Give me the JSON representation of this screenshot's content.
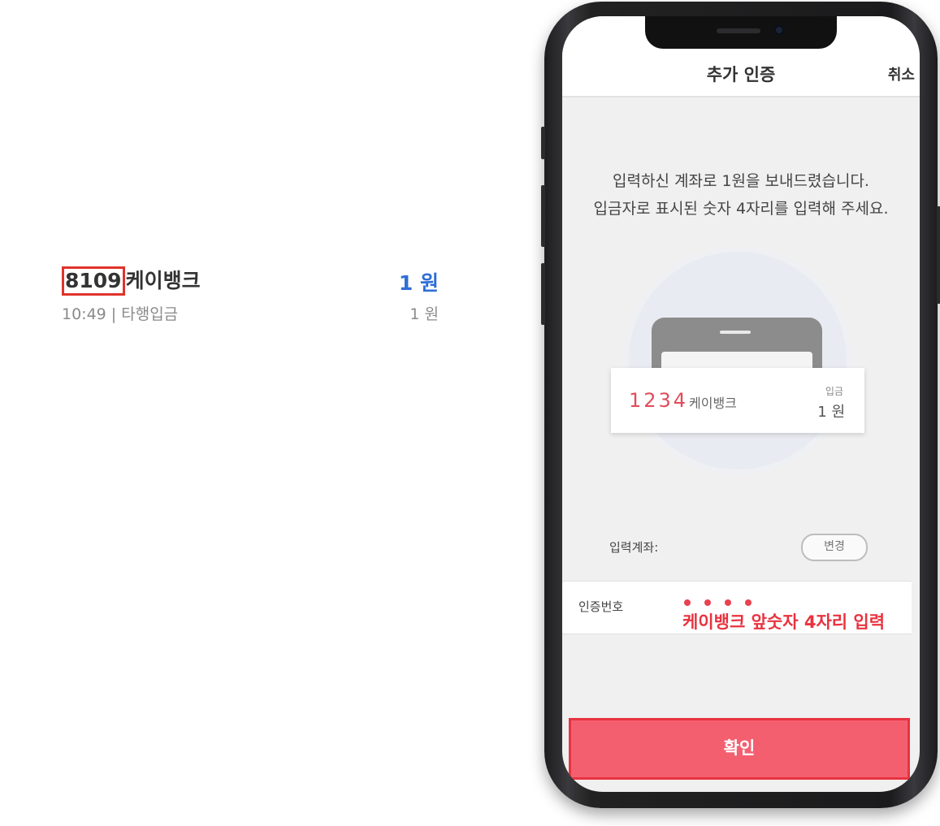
{
  "transaction": {
    "code": "8109",
    "name": "케이뱅크",
    "amount": "1 원",
    "meta": "10:49 | 타행입금",
    "meta_amount": "1 원"
  },
  "phone": {
    "header": {
      "title": "추가 인증",
      "cancel_label": "취소"
    },
    "instruction": {
      "line1": "입력하신 계좌로 1원을 보내드렸습니다.",
      "line2": "입금자로 표시된 숫자 4자리를 입력해 주세요."
    },
    "illustration": {
      "code": "1234",
      "name": "케이뱅크",
      "deposit_label": "입금",
      "amount": "1 원"
    },
    "account": {
      "label": "입력계좌:",
      "change_label": "변경"
    },
    "verification": {
      "label": "인증번호",
      "hint": "케이뱅크 앞숫자 4자리 입력",
      "dots_count": 4
    },
    "confirm_label": "확인"
  },
  "colors": {
    "accent_red": "#e8333f",
    "confirm_bg": "#f45f70",
    "amount_blue": "#2f6fd6"
  }
}
